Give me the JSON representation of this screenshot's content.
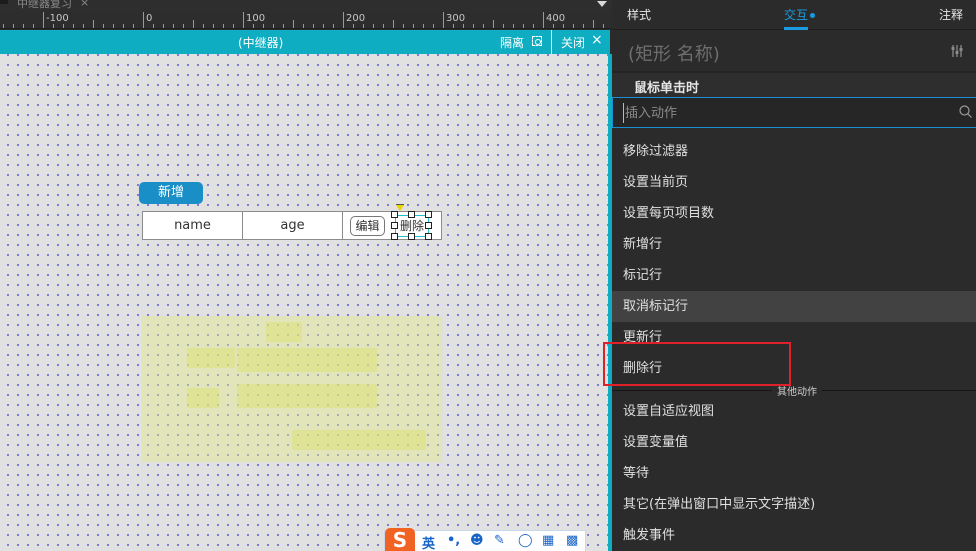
{
  "document_tab": {
    "title": "中继器复习",
    "close_icon": "×"
  },
  "ruler": {
    "labels": [
      "-100",
      "0",
      "100",
      "200",
      "300",
      "400"
    ]
  },
  "canvas_header": {
    "title": "(中继器)",
    "isolate_label": "隔离",
    "close_label": "关闭",
    "close_icon": "×"
  },
  "canvas": {
    "add_button": "新增",
    "repeater_row": {
      "name": "name",
      "age": "age",
      "edit_button": "编辑",
      "delete_button": "删除"
    }
  },
  "ime_toolbar": {
    "logo": "S",
    "items": [
      "英",
      "•,",
      "☻",
      "✎",
      "◯",
      "▦",
      "▩"
    ]
  },
  "panel": {
    "tabs": [
      {
        "label": "样式",
        "active": false
      },
      {
        "label": "交互",
        "active": true
      },
      {
        "label": "注释",
        "active": false
      }
    ],
    "widget_name": "(矩形 名称)",
    "event_title": "鼠标单击时",
    "search": {
      "placeholder": "插入动作",
      "value": ""
    },
    "actions": [
      {
        "label": "移除过滤器"
      },
      {
        "label": "设置当前页"
      },
      {
        "label": "设置每页项目数"
      },
      {
        "label": "新增行"
      },
      {
        "label": "标记行"
      },
      {
        "label": "取消标记行",
        "hovered": true
      },
      {
        "label": "更新行"
      },
      {
        "label": "删除行",
        "highlighted": true
      }
    ],
    "other_section_label": "其他动作",
    "other_actions": [
      {
        "label": "设置自适应视图"
      },
      {
        "label": "设置变量值"
      },
      {
        "label": "等待"
      },
      {
        "label": "其它(在弹出窗口中显示文字描述)"
      },
      {
        "label": "触发事件"
      }
    ]
  },
  "colors": {
    "accent": "#1a9be0",
    "canvas_header": "#0fadc1",
    "add_button": "#1a8fc7",
    "highlight_box": "#e0202a",
    "hover_row": "#424242"
  }
}
